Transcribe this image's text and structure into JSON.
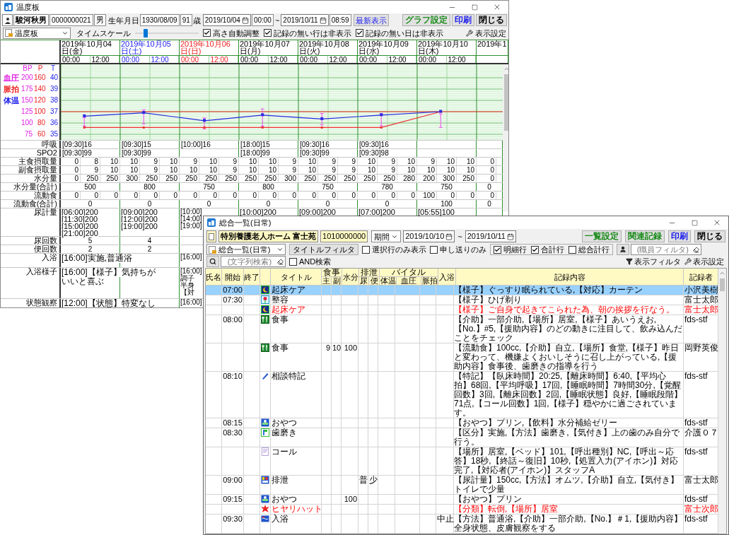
{
  "back_window": {
    "title": "温度板",
    "patient": {
      "name": "駿河秋男",
      "id": "0000000021",
      "sex": "男"
    },
    "birth_label": "生年月日",
    "birth_date": "1930/08/09",
    "age": "91",
    "age_unit": "歳",
    "from_date": "2019/10/04",
    "from_time": "00:00",
    "range_sep": "~",
    "to_date": "2019/10/11",
    "to_time": "08:59",
    "refresh_button": "最新表示",
    "buttons": [
      {
        "label": "グラフ設定",
        "color": "#1a8a1a"
      },
      {
        "label": "印刷",
        "color": "#1a1aee"
      },
      {
        "label": "閉じる",
        "color": "#000000"
      }
    ],
    "view_select": "温度板",
    "timescale_label": "タイムスケール",
    "timescale": {
      "level": 0.17
    },
    "options": [
      {
        "label": "高さ自動調整",
        "checked": true
      },
      {
        "label": "記録の無い行は非表示",
        "checked": true
      },
      {
        "label": "記録の無い日は非表示",
        "checked": true
      }
    ],
    "display_settings": "表示設定",
    "days": [
      {
        "date": "2019年10月04日(金)",
        "color": "#000000",
        "times": [
          "00:00",
          "12:00"
        ]
      },
      {
        "date": "2019年10月05日(土)",
        "color": "#2222ee",
        "times": [
          "00:00",
          "12:00"
        ]
      },
      {
        "date": "2019年10月06日(日)",
        "color": "#ee2222",
        "times": [
          "00:00",
          "12:00"
        ]
      },
      {
        "date": "2019年10月07日(月)",
        "color": "#000000",
        "times": [
          "00:00",
          "12:00"
        ]
      },
      {
        "date": "2019年10月08日(火)",
        "color": "#000000",
        "times": [
          "00:00",
          "12:00"
        ]
      },
      {
        "date": "2019年10月09日(水)",
        "color": "#000000",
        "times": [
          "00:00",
          "12:00"
        ]
      },
      {
        "date": "2019年10月10日(木)",
        "color": "#000000",
        "times": [
          "00:00",
          "12:00"
        ]
      },
      {
        "date": "2019年1",
        "color": "#000000"
      }
    ],
    "chart": {
      "kind": "picture",
      "scale_header": [
        "BP",
        "P",
        "T"
      ],
      "scale_rows": [
        {
          "label": "血圧",
          "color": "#e020e0",
          "values": [
            "200",
            "160",
            "40"
          ]
        },
        {
          "label": "脈拍",
          "color": "#ee2222",
          "values": [
            "175",
            "140",
            "39"
          ]
        },
        {
          "label": "体温",
          "color": "#2222ee",
          "values": [
            "150",
            "120",
            "38"
          ]
        },
        {
          "values": [
            "125",
            "100",
            "37"
          ]
        },
        {
          "values": [
            "100",
            "80",
            "36"
          ]
        },
        {
          "values": [
            "75",
            "60",
            "35"
          ]
        }
      ]
    },
    "rows": [
      {
        "label": "呼吸",
        "kind": "daily",
        "cells": [
          "[09:30]16",
          "[09:30]15",
          "[10:00]16",
          "[18:00]15",
          "[09:30]16",
          "[09:30]16",
          null,
          null
        ]
      },
      {
        "label": "SPO2",
        "kind": "daily",
        "cells": [
          "[09:30]99",
          "[09:30]99",
          null,
          "[18:00]99",
          "[09:30]99",
          "[09:30]98",
          null,
          null
        ]
      },
      {
        "label": "主食摂取量",
        "kind": "meals",
        "cells": [
          [
            "0",
            "8",
            "10"
          ],
          [
            "10",
            "9",
            "10"
          ],
          [
            "9",
            "10",
            "9"
          ],
          [
            "10",
            "10",
            "9"
          ],
          [
            "10",
            "9",
            "9"
          ],
          [
            "10",
            "9",
            "10"
          ],
          [
            "9",
            "10",
            "10"
          ],
          [
            "0"
          ]
        ]
      },
      {
        "label": "副食摂取量",
        "kind": "meals",
        "cells": [
          [
            "0",
            "9",
            "10"
          ],
          [
            "10",
            "9",
            "10"
          ],
          [
            "10",
            "10",
            "9"
          ],
          [
            "10",
            "10",
            "9"
          ],
          [
            "10",
            "9",
            "9"
          ],
          [
            "10",
            "9",
            "10"
          ],
          [
            "10",
            "10",
            "10"
          ],
          [
            "0"
          ]
        ]
      },
      {
        "label": "水分量",
        "kind": "meals",
        "cells": [
          [
            "0",
            "250",
            "250"
          ],
          [
            "300",
            "250",
            "250"
          ],
          [
            "250",
            "250",
            "250"
          ],
          [
            "250",
            "250",
            "300"
          ],
          [
            "250",
            "250",
            "250"
          ],
          [
            "250",
            "250",
            "280"
          ],
          [
            "200",
            "300",
            "250"
          ],
          [
            "0"
          ]
        ]
      },
      {
        "label": "水分量(合計)",
        "kind": "total",
        "cells": [
          "500",
          "800",
          "750",
          "800",
          "750",
          "780",
          "750",
          "0"
        ]
      },
      {
        "label": "流動食",
        "kind": "meals",
        "cells": [
          [
            "0",
            "0",
            "0"
          ],
          [
            "0",
            "0",
            "0"
          ],
          [
            "0",
            "0",
            "0"
          ],
          [
            "0",
            "0",
            "0"
          ],
          [
            "0",
            "0",
            "0"
          ],
          [
            "0",
            "0",
            "0"
          ],
          [
            "100",
            "0",
            "0"
          ],
          [
            "0"
          ]
        ]
      },
      {
        "label": "流動食(合計)",
        "kind": "total",
        "cells": [
          "0",
          "0",
          "0",
          "0",
          "0",
          "0",
          "100",
          "0"
        ]
      },
      {
        "label": "尿計量",
        "kind": "notes",
        "cells": [
          [
            "[06:00]200",
            "[11:30]200",
            "[15:00]200",
            "[21:00]200"
          ],
          [
            "[09:00]200",
            "[12:00]200",
            "[19:00]200"
          ],
          [
            "[10:00]",
            "[14:00]",
            "[19:00]"
          ],
          [
            "[10:00]200"
          ],
          [
            "[09:00]200"
          ],
          [
            "[07:00]200"
          ],
          [
            "[05:55]100"
          ]
        ]
      },
      {
        "label": "尿回数",
        "kind": "total",
        "cells": [
          "5",
          "4"
        ]
      },
      {
        "label": "便回数",
        "kind": "total",
        "cells": [
          "2",
          "2"
        ]
      },
      {
        "label": "入浴",
        "kind": "notes",
        "cells": [
          [
            "[16:00]実施,普通浴"
          ],
          null,
          [
            "[16:00]"
          ]
        ]
      },
      {
        "label": "入浴様子",
        "kind": "notes",
        "cells": [
          [
            "[16:00]【様子】気持ちが",
            "いいと喜ぶ"
          ],
          null,
          [
            "[16:00]",
            "調子",
            "半身",
            "【対"
          ]
        ]
      },
      {
        "label": "状態観察",
        "kind": "notes",
        "cells": [
          [
            "[12:00]【状態】特変なし"
          ],
          null,
          [
            "[16:00]"
          ]
        ]
      }
    ]
  },
  "front_window": {
    "title": "総合一覧(日常)",
    "facility": "特別養護老人ホーム 富士苑",
    "facility_id": "1010000000",
    "period_select": "期間",
    "from_date": "2019/10/10",
    "range_sep": "~",
    "to_date": "2019/10/11",
    "buttons": [
      {
        "label": "一覧設定",
        "color": "#1a8a1a"
      },
      {
        "label": "関連記録",
        "color": "#1a8a1a"
      },
      {
        "label": "印刷",
        "color": "#1a1aee"
      },
      {
        "label": "閉じる",
        "color": "#000000"
      }
    ],
    "view_select": "総合一覧(日常)",
    "title_filter": "タイトルフィルタ",
    "filters": [
      {
        "label": "選択行のみ表示",
        "checked": false
      },
      {
        "label": "申し送りのみ",
        "checked": false
      }
    ],
    "row_types": [
      {
        "label": "明細行",
        "checked": true
      },
      {
        "label": "合計行",
        "checked": true
      },
      {
        "label": "総合計行",
        "checked": false
      }
    ],
    "staff_filter": {
      "placeholder": "(職員フィルタ)"
    },
    "text_search": {
      "placeholder": "(文字列検索)"
    },
    "and_search": {
      "label": "AND検索",
      "checked": false
    },
    "display_filter": "表示フィルタ",
    "display_settings": "表示設定",
    "columns": [
      "氏名",
      "開始",
      "終了",
      "タイトル",
      {
        "group": "食事",
        "subs": [
          "主",
          "副"
        ]
      },
      "水分",
      {
        "group": "排泄",
        "subs": [
          "尿",
          "便"
        ]
      },
      {
        "group": "バイタル",
        "subs": [
          "体温",
          "血圧",
          "脈拍"
        ]
      },
      "入浴",
      "記録内容",
      "記録者"
    ],
    "rows": [
      {
        "start": "07:00",
        "title": "起床ケア",
        "content": "【様子】ぐっすり眠られている,【対応】カーテン",
        "recorder": "小沢美樹",
        "selected": true,
        "emphasized": false
      },
      {
        "start": "07:30",
        "title": "整容",
        "content": "【様子】ひげ剃り",
        "recorder": "富士太郎",
        "selected": false,
        "emphasized": false
      },
      {
        "title": "起床ケア",
        "content": "【様子】ご自身で起きてこられた為、朝の挨拶を行なう。",
        "recorder": "富士太郎",
        "selected": false,
        "emphasized": true
      },
      {
        "start": "08:00",
        "title": "食事",
        "content": "【介助】一部介助,【場所】居室,【様子】あいうえお,【No.】#5,【援助内容】のどの動きに注目して、飲み込んだことをチェック",
        "recorder": "fds-stf",
        "selected": false,
        "emphasized": false
      },
      {
        "title": "食事",
        "main": "9",
        "side": "10",
        "water": "100",
        "content": "【流動食】100cc,【介助】自立,【場所】食堂,【様子】昨日と変わって、機嫌よくおいしそうに召し上がっている,【援助内容】食事後、歯磨きの指導を行う",
        "recorder": "岡野英俊",
        "selected": false,
        "emphasized": false
      },
      {
        "start": "08:10",
        "title": "相談特記",
        "content": "【特記】【臥床時間】20:25,【離床時間】6:40,【平均心拍】68回,【平均呼吸】17回,【睡眠時間】7時間30分,【覚醒回数】3回,【離床回数】2回,【睡眠状態】良好,【睡眠段階】71点,【コール回数】1回,【様子】穏やかに過ごされています。",
        "recorder": "fds-stf",
        "selected": false,
        "emphasized": false
      },
      {
        "start": "08:15",
        "title": "おやつ",
        "content": "【おやつ】プリン,【飲料】水分補給ゼリー",
        "recorder": "fds-stf",
        "selected": false,
        "emphasized": false
      },
      {
        "start": "08:30",
        "title": "歯磨き",
        "content": "【区分】実施,【方法】歯磨き,【気付き】上の歯のみ自分で行う。",
        "recorder": "介護０７",
        "selected": false,
        "emphasized": false
      },
      {
        "title": "コール",
        "content": "【場所】居室,【ベッド】101,【呼出種別】NC,【呼出～応答】18秒,【終話～復旧】10秒,【処置入力(アイホン)】対応完了,【対応者(アイホン)】スタッフA",
        "recorder": "fds-stf",
        "selected": false,
        "emphasized": false
      },
      {
        "start": "09:00",
        "title": "排泄",
        "urine": "普",
        "stool": "少",
        "content": "【尿計量】150cc,【方法】オムツ,【介助】自立,【気付き】トイレで少量",
        "recorder": "富士太郎",
        "selected": false,
        "emphasized": false
      },
      {
        "start": "09:15",
        "title": "おやつ",
        "water": "100",
        "content": "【おやつ】プリン",
        "recorder": "fds-stf",
        "selected": false,
        "emphasized": false
      },
      {
        "title": "ヒヤリハット",
        "content": "【分類】転倒,【場所】居室",
        "recorder": "富士次郎",
        "selected": false,
        "emphasized": true
      },
      {
        "start": "09:30",
        "title": "入浴",
        "bath": "中止",
        "content": "【方法】普通浴,【介助】一部介助,【No.】＃1,【援助内容】全身状態、皮膚観察をする",
        "recorder": "fds-stf",
        "selected": false,
        "emphasized": false
      }
    ]
  }
}
